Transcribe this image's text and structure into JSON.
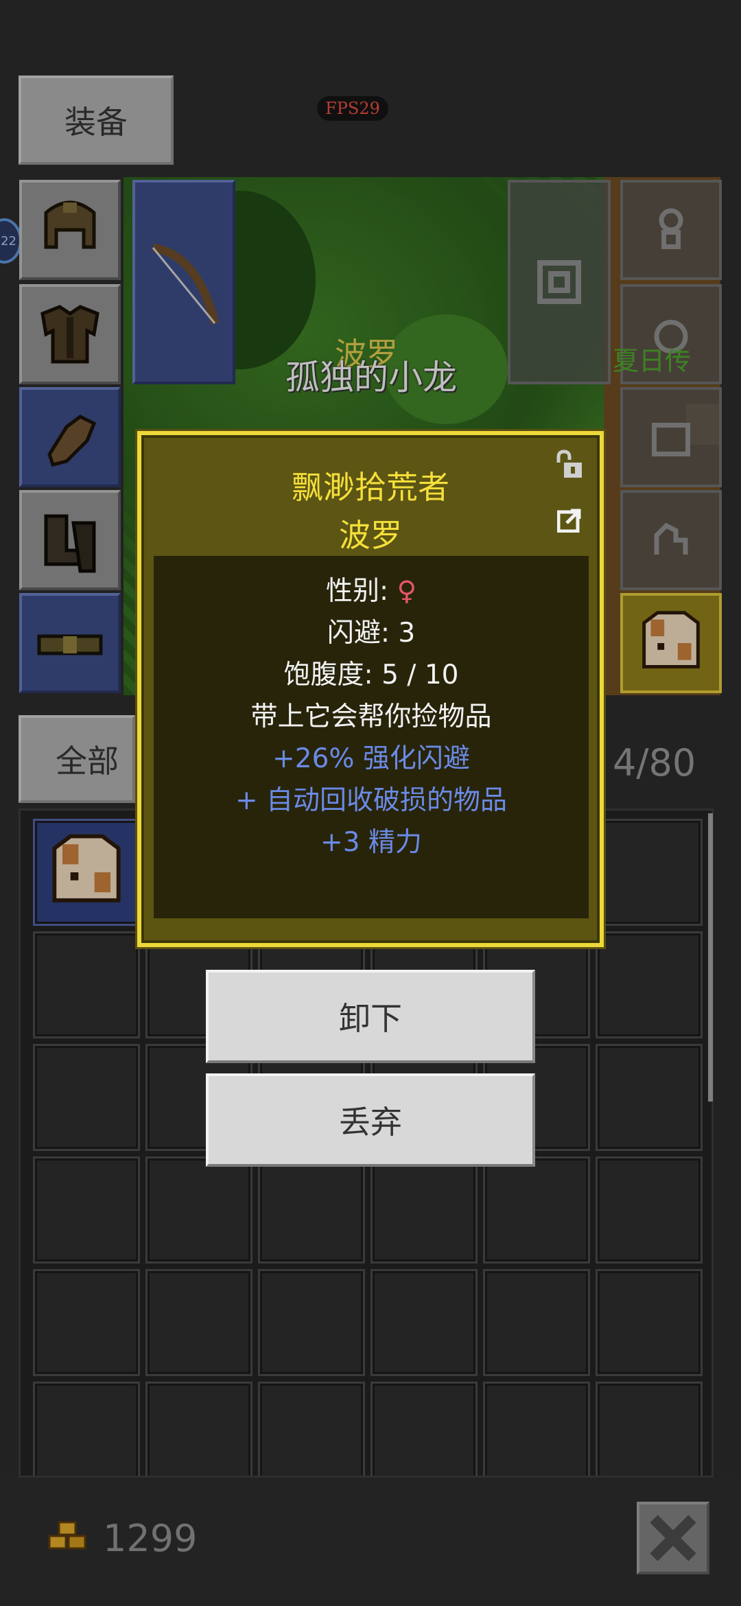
{
  "fps_label": "FPS29",
  "equip_tab_label": "装备",
  "level_badge": "22",
  "pet": {
    "name_overhead": "波罗",
    "owner_name": "孤独的小龙",
    "side_text": "夏日传"
  },
  "bag": {
    "filter_label": "全部",
    "count": "4/80"
  },
  "gold": "1299",
  "popup": {
    "title": "飘渺拾荒者",
    "subtitle": "波罗",
    "gender_label": "性别: ",
    "gender_symbol": "♀",
    "dodge": "闪避: 3",
    "satiety": "饱腹度: 5 / 10",
    "desc": "带上它会帮你捡物品",
    "bonus1": "+26% 强化闪避",
    "bonus2": "+ 自动回收破损的物品",
    "bonus3": "+3 精力"
  },
  "buttons": {
    "unequip": "卸下",
    "discard": "丢弃"
  },
  "colors": {
    "popup_border": "#ecd93a",
    "popup_title": "#f5df3a",
    "bonus_text": "#6b8ae6",
    "female": "#e5566a",
    "fps_text": "#e04a3d"
  }
}
